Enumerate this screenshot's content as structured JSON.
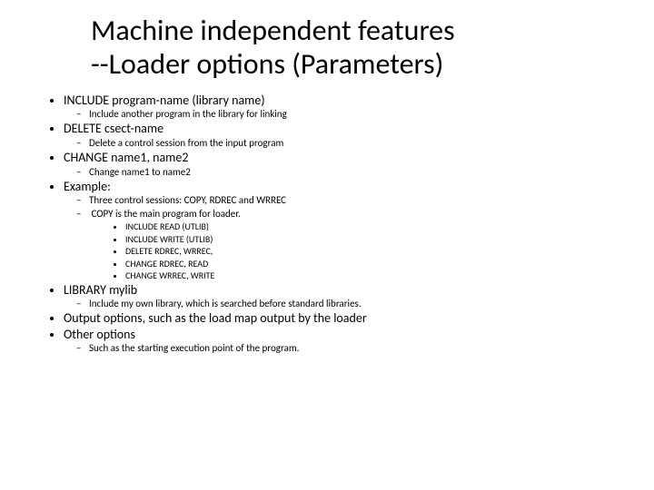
{
  "title_line1": "Machine independent features",
  "title_line2": "--Loader options (Parameters)",
  "items": {
    "p1": "INCLUDE program-name (library name)",
    "p1s1": "Include another program in the library for linking",
    "p2": "DELETE csect-name",
    "p2s1": "Delete a control session from the input program",
    "p3": "CHANGE name1, name2",
    "p3s1": "Change name1 to name2",
    "p4": "Example:",
    "p4s1": "Three control sessions: COPY, RDREC and WRREC",
    "p4s2": "COPY is the main program for loader.",
    "p4s2a": "INCLUDE READ (UTLIB)",
    "p4s2b": "INCLUDE WRITE (UTLIB)",
    "p4s2c": "DELETE RDREC, WRREC,",
    "p4s2d": "CHANGE RDREC, READ",
    "p4s2e": "CHANGE WRREC, WRITE",
    "p5": "LIBRARY mylib",
    "p5s1": "Include my own library, which is searched before standard libraries.",
    "p6": "Output options, such as the load map output by the loader",
    "p7": "Other options",
    "p7s1": "Such as the starting execution point of the program."
  }
}
